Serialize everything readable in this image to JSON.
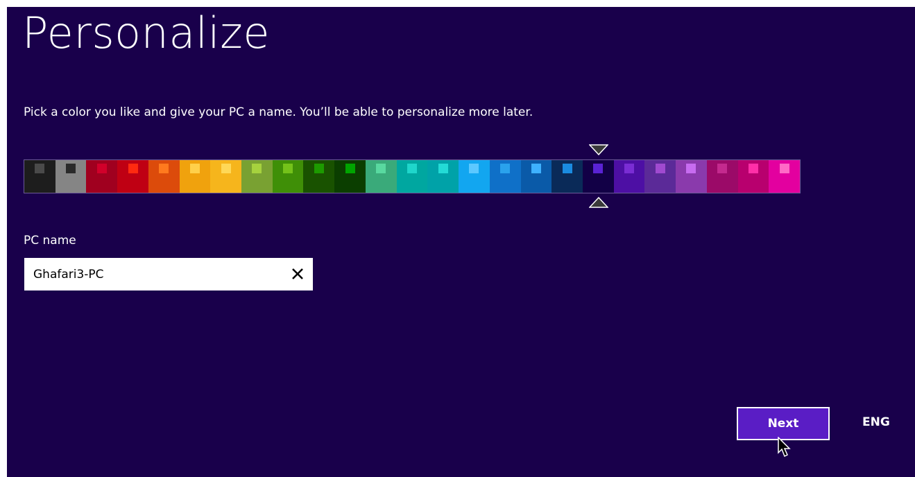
{
  "page": {
    "title": "Personalize",
    "subtitle": "Pick a color you like and give your PC a name. You’ll be able to personalize more later."
  },
  "colors": {
    "background": "#19004b",
    "button": "#5a1dc5",
    "text": "#ffffff"
  },
  "palette": {
    "selected_index": 20,
    "swatches": [
      {
        "bg": "#1d1d1d",
        "accent": "#4a4a4a"
      },
      {
        "bg": "#858585",
        "accent": "#2a2a2a"
      },
      {
        "bg": "#a0001f",
        "accent": "#d1002a"
      },
      {
        "bg": "#bf0013",
        "accent": "#ff2a10"
      },
      {
        "bg": "#dc4b0b",
        "accent": "#ff7a1e"
      },
      {
        "bg": "#f0a20d",
        "accent": "#ffd04a"
      },
      {
        "bg": "#f6b51c",
        "accent": "#ffd857"
      },
      {
        "bg": "#79a132",
        "accent": "#a6d23e"
      },
      {
        "bg": "#3f8f07",
        "accent": "#74c21a"
      },
      {
        "bg": "#195200",
        "accent": "#1d9a00"
      },
      {
        "bg": "#0b3e00",
        "accent": "#00a400"
      },
      {
        "bg": "#3aaa7a",
        "accent": "#59d9a0"
      },
      {
        "bg": "#00a7a0",
        "accent": "#1fd6cb"
      },
      {
        "bg": "#00a2a8",
        "accent": "#23dbd6"
      },
      {
        "bg": "#12a6f0",
        "accent": "#5cc8ff"
      },
      {
        "bg": "#0f70c8",
        "accent": "#2aa2ec"
      },
      {
        "bg": "#0a5aa8",
        "accent": "#3eb1ff"
      },
      {
        "bg": "#0a2a58",
        "accent": "#1a8be0"
      },
      {
        "bg": "#120046",
        "accent": "#5a22d4"
      },
      {
        "bg": "#4d0fa4",
        "accent": "#7a2dd4"
      },
      {
        "bg": "#5b2a98",
        "accent": "#a04ad0"
      },
      {
        "bg": "#8a3aac",
        "accent": "#c76cf0"
      },
      {
        "bg": "#9b0a68",
        "accent": "#c42a8e"
      },
      {
        "bg": "#b8006e",
        "accent": "#ff2fa8"
      },
      {
        "bg": "#e3009f",
        "accent": "#ff6ac6"
      }
    ]
  },
  "pc_name": {
    "label": "PC name",
    "value": "Ghafari3-PC",
    "clear_icon": "close-icon"
  },
  "buttons": {
    "next_label": "Next"
  },
  "language": {
    "label": "ENG"
  }
}
